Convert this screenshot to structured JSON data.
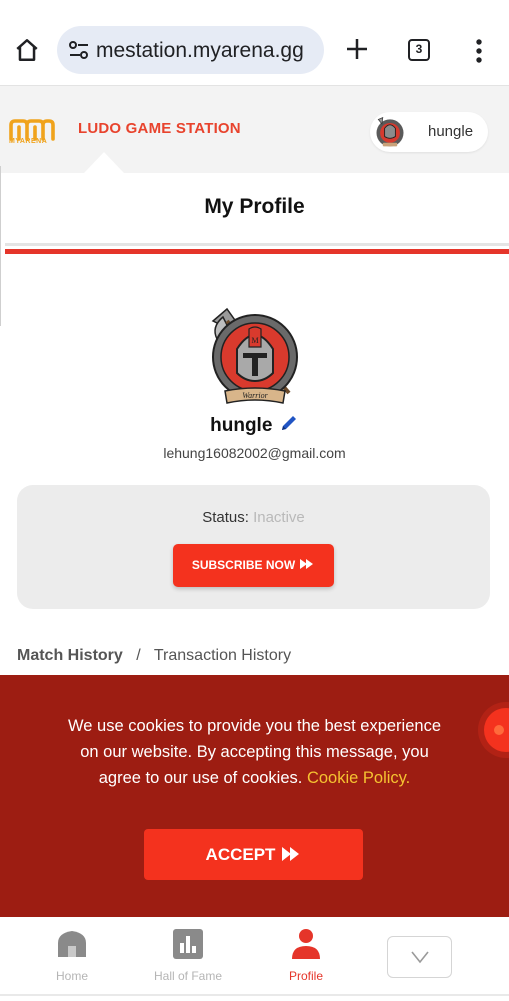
{
  "browser": {
    "url": "mestation.myarena.gg",
    "tab_count": "3"
  },
  "header": {
    "logo_text": "MYARENA",
    "site_title": "LUDO GAME STATION",
    "username": "hungle"
  },
  "profile": {
    "title": "My Profile",
    "name": "hungle",
    "email": "lehung16082002@gmail.com",
    "badge_text": "Warrior",
    "status_label": "Status:",
    "status_value": "Inactive",
    "subscribe_label": "SUBSCRIBE NOW"
  },
  "history": {
    "match_label": "Match History",
    "separator": "/",
    "transaction_label": "Transaction History"
  },
  "cookie_banner": {
    "message": "We use cookies to provide you the best experience on our website. By accepting this message, you agree to our use of cookies.",
    "policy_link": "Cookie Policy.",
    "accept_label": "ACCEPT"
  },
  "bottom_nav": {
    "items": [
      {
        "label": "Home",
        "icon": "home-icon"
      },
      {
        "label": "Hall of Fame",
        "icon": "chart-icon"
      },
      {
        "label": "Profile",
        "icon": "person-icon"
      }
    ]
  },
  "colors": {
    "brand_red": "#e5352a",
    "button_red": "#f4321e",
    "banner_red": "#9d1d12",
    "policy_yellow": "#f5c231",
    "logo_orange": "#f0a31c"
  }
}
